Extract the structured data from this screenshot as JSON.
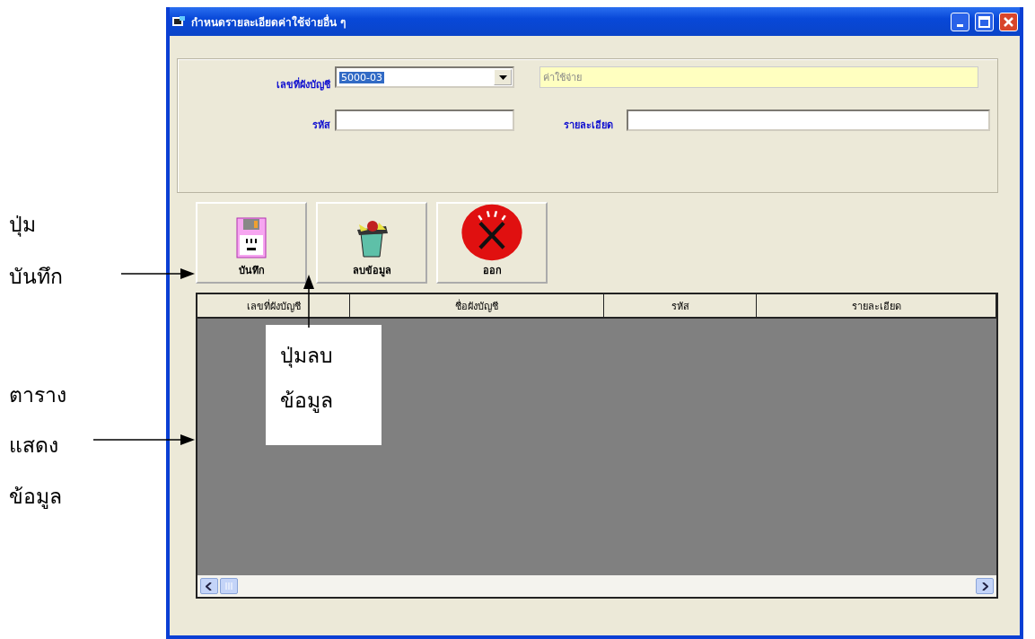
{
  "window": {
    "title": "กำหนดรายละเอียดค่าใช้จ่ายอื่น ๆ"
  },
  "form": {
    "account_no": {
      "label": "เลขที่ผังบัญชี",
      "value": "5000-03"
    },
    "account_name": {
      "value": "ค่าใช้จ่าย"
    },
    "code": {
      "label": "รหัส"
    },
    "detail": {
      "label": "รายละเอียด"
    }
  },
  "buttons": [
    {
      "kind": "save",
      "label": "บันทึก"
    },
    {
      "kind": "delete",
      "label": "ลบข้อมูล"
    },
    {
      "kind": "exit",
      "label": "ออก"
    }
  ],
  "table": {
    "columns": [
      "เลขที่ผังบัญชี",
      "ชื่อผังบัญชี",
      "รหัส",
      "รายละเอียด"
    ]
  },
  "annotations": {
    "save_button": [
      "ปุ่ม",
      "บันทึก"
    ],
    "delete_button": [
      "ปุ่มลบ",
      "ข้อมูล"
    ],
    "table": [
      "ตาราง",
      "แสดง",
      "ข้อมูล"
    ]
  }
}
